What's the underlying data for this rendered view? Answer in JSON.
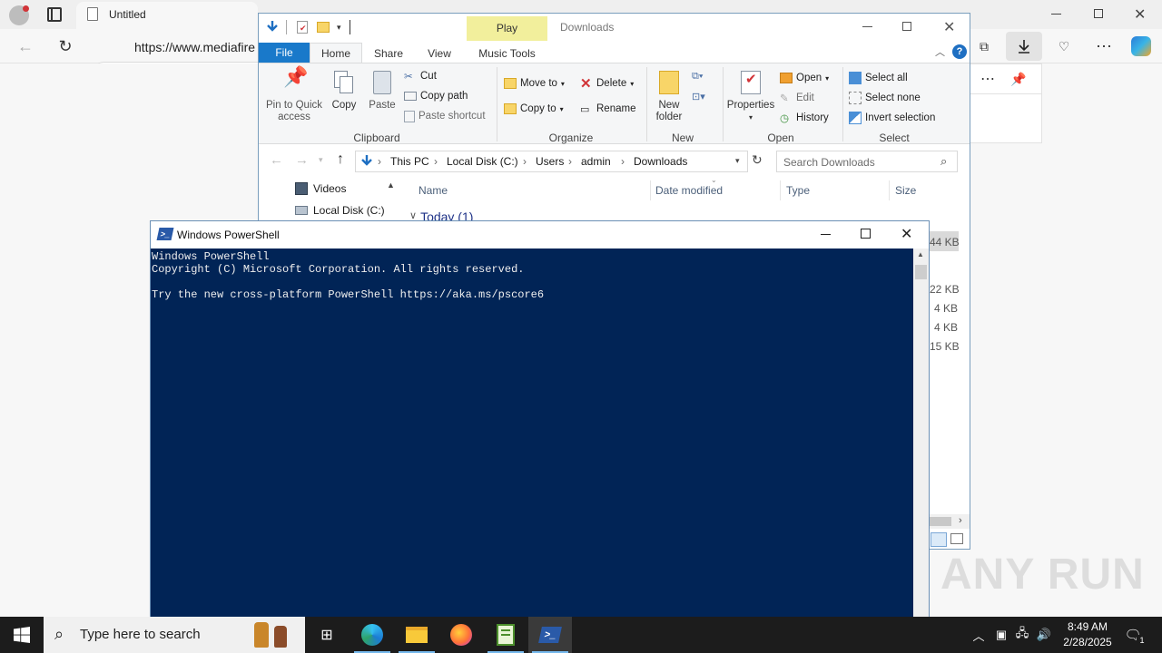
{
  "browser": {
    "tab_title": "Untitled",
    "url": "https://www.mediafire"
  },
  "explorer": {
    "window_title": "Downloads",
    "context_tab_group": "Play",
    "ribbon_tabs": [
      "File",
      "Home",
      "Share",
      "View",
      "Music Tools"
    ],
    "clipboard": {
      "pin_label": "Pin to Quick access",
      "copy_label": "Copy",
      "paste_label": "Paste",
      "cut_label": "Cut",
      "copy_path_label": "Copy path",
      "paste_shortcut_label": "Paste shortcut",
      "group_label": "Clipboard"
    },
    "organize": {
      "move_to_label": "Move to",
      "copy_to_label": "Copy to",
      "delete_label": "Delete",
      "rename_label": "Rename",
      "group_label": "Organize"
    },
    "new_group": {
      "new_folder_label": "New folder",
      "group_label": "New"
    },
    "open_group": {
      "properties_label": "Properties",
      "open_label": "Open",
      "edit_label": "Edit",
      "history_label": "History",
      "group_label": "Open"
    },
    "select_group": {
      "select_all_label": "Select all",
      "select_none_label": "Select none",
      "invert_label": "Invert selection",
      "group_label": "Select"
    },
    "breadcrumb": [
      "This PC",
      "Local Disk (C:)",
      "Users",
      "admin",
      "Downloads"
    ],
    "search_placeholder": "Search Downloads",
    "nav_items": [
      "Videos",
      "Local Disk (C:)"
    ],
    "columns": [
      "Name",
      "Date modified",
      "Type",
      "Size"
    ],
    "group_header": "Today (1)",
    "file_sizes": [
      "44 KB",
      "22 KB",
      "4 KB",
      "4 KB",
      "15 KB"
    ]
  },
  "powershell": {
    "window_title": "Windows PowerShell",
    "lines": [
      "Windows PowerShell",
      "Copyright (C) Microsoft Corporation. All rights reserved.",
      "",
      "Try the new cross-platform PowerShell https://aka.ms/pscore6"
    ]
  },
  "taskbar": {
    "search_placeholder": "Type here to search",
    "time": "8:49 AM",
    "date": "2/28/2025",
    "notification_count": "1"
  },
  "watermark": "ANY RUN",
  "colors": {
    "ps_background": "#012456",
    "ribbon_file_tab": "#1979ca",
    "context_tab": "#f2ef9c",
    "taskbar": "#1c1c1c"
  }
}
